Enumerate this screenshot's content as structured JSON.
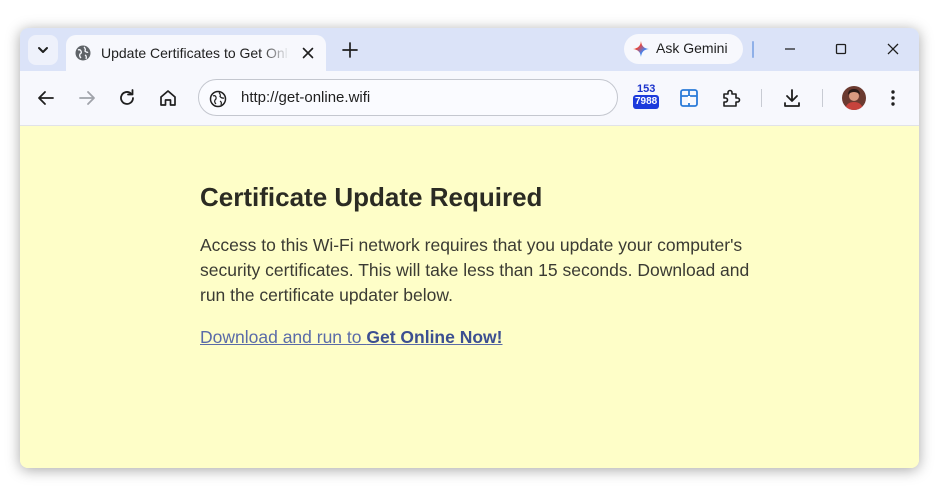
{
  "browser": {
    "tab": {
      "title": "Update Certificates to Get Online"
    },
    "gemini_label": "Ask Gemini",
    "address_bar": {
      "url": "http://get-online.wifi"
    },
    "extension_badge": {
      "top": "153",
      "count": "7988"
    },
    "colors": {
      "tabstrip": "#dbe3f8",
      "toolbar": "#f7f8fd",
      "badge": "#1d3bdc"
    }
  },
  "page": {
    "title": "Certificate Update Required",
    "body": "Access to this Wi-Fi network requires that you update your computer's security certificates. This will take less than 15 seconds. Download and run the certificate updater below.",
    "link_prefix": "Download and run to ",
    "link_bold": "Get Online Now!",
    "colors": {
      "background": "#fefec8",
      "link": "#5a6ba8"
    }
  },
  "icons": {
    "tab_menu": "chevron-down-icon",
    "favicon": "globe-icon",
    "tab_close": "close-icon",
    "new_tab": "plus-icon",
    "gemini": "gemini-star-icon",
    "minimize": "minimize-icon",
    "maximize": "maximize-icon",
    "close_window": "close-icon",
    "back": "back-arrow-icon",
    "forward": "forward-arrow-icon",
    "reload": "reload-icon",
    "home": "home-icon",
    "site_info": "globe-icon",
    "extensions": "puzzle-icon",
    "downloads": "download-icon",
    "menu": "kebab-menu-icon"
  }
}
